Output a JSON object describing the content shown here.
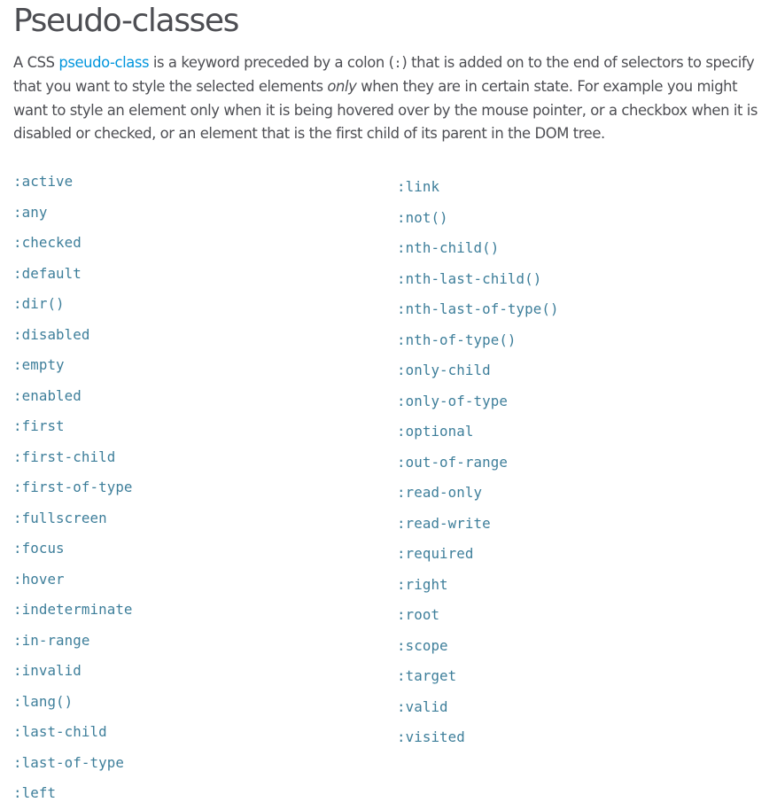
{
  "heading": "Pseudo-classes",
  "intro": {
    "text_1": "A CSS ",
    "link_text": "pseudo-class",
    "text_2": " is a keyword preceded by a colon (",
    "code": ":",
    "text_3": ") that is added on to the end of selectors to specify that you want to style the selected elements ",
    "emphasis": "only",
    "text_4": " when they are in certain state. For example you might want to style an element only when it is being hovered over by the mouse pointer, or a checkbox when it is disabled or checked, or an element that is the first child of its parent in the DOM tree."
  },
  "pseudo_classes_left": [
    ":active",
    ":any",
    ":checked",
    ":default",
    ":dir()",
    ":disabled",
    ":empty",
    ":enabled",
    ":first",
    ":first-child",
    ":first-of-type",
    ":fullscreen",
    ":focus",
    ":hover",
    ":indeterminate",
    ":in-range",
    ":invalid",
    ":lang()",
    ":last-child",
    ":last-of-type",
    ":left"
  ],
  "pseudo_classes_right": [
    ":link",
    ":not()",
    ":nth-child()",
    ":nth-last-child()",
    ":nth-last-of-type()",
    ":nth-of-type()",
    ":only-child",
    ":only-of-type",
    ":optional",
    ":out-of-range",
    ":read-only",
    ":read-write",
    ":required",
    ":right",
    ":root",
    ":scope",
    ":target",
    ":valid",
    ":visited"
  ],
  "colors": {
    "heading": "#4d4e53",
    "body_text": "#4d4e53",
    "inline_link": "#0095dd",
    "code_link": "#3d7e9a",
    "background": "#ffffff"
  }
}
